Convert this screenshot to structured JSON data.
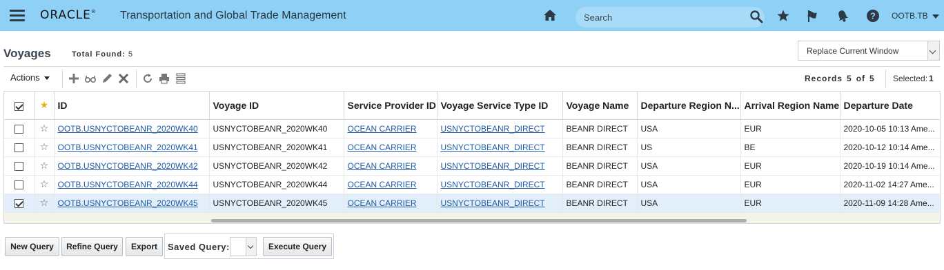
{
  "header": {
    "logo": "ORACLE",
    "logo_mark": "®",
    "app_title": "Transportation and Global Trade Management",
    "search_placeholder": "Search",
    "user": "OOTB.TB"
  },
  "page": {
    "title": "Voyages",
    "total_label": "Total Found:",
    "total_value": "5",
    "window_option": "Replace Current Window"
  },
  "toolbar": {
    "actions_label": "Actions",
    "records_label": "Records",
    "records_current": "5",
    "records_of": "of",
    "records_total": "5",
    "selected_label": "Selected:",
    "selected_value": "1"
  },
  "table": {
    "columns": [
      "ID",
      "Voyage ID",
      "Service Provider ID",
      "Voyage Service Type ID",
      "Voyage Name",
      "Departure Region N...",
      "Arrival Region Name",
      "Departure Date"
    ],
    "rows": [
      {
        "checked": false,
        "id": "OOTB.USNYCTOBEANR_2020WK40",
        "voyage_id": "USNYCTOBEANR_2020WK40",
        "provider": "OCEAN CARRIER",
        "service_type": "USNYCTOBEANR_DIRECT",
        "name": "BEANR DIRECT",
        "dep_region": "USA",
        "arr_region": "EUR",
        "dep_date": "2020-10-05 10:13 Ame..."
      },
      {
        "checked": false,
        "id": "OOTB.USNYCTOBEANR_2020WK41",
        "voyage_id": "USNYCTOBEANR_2020WK41",
        "provider": "OCEAN CARRIER",
        "service_type": "USNYCTOBEANR_DIRECT",
        "name": "BEANR DIRECT",
        "dep_region": "US",
        "arr_region": "BE",
        "dep_date": "2020-10-12 10:14 Ame..."
      },
      {
        "checked": false,
        "id": "OOTB.USNYCTOBEANR_2020WK42",
        "voyage_id": "USNYCTOBEANR_2020WK42",
        "provider": "OCEAN CARRIER",
        "service_type": "USNYCTOBEANR_DIRECT",
        "name": "BEANR DIRECT",
        "dep_region": "USA",
        "arr_region": "EUR",
        "dep_date": "2020-10-19 10:14 Ame..."
      },
      {
        "checked": false,
        "id": "OOTB.USNYCTOBEANR_2020WK44",
        "voyage_id": "USNYCTOBEANR_2020WK44",
        "provider": "OCEAN CARRIER",
        "service_type": "USNYCTOBEANR_DIRECT",
        "name": "BEANR DIRECT",
        "dep_region": "USA",
        "arr_region": "EUR",
        "dep_date": "2020-11-02 14:27 Ame..."
      },
      {
        "checked": true,
        "id": "OOTB.USNYCTOBEANR_2020WK45",
        "voyage_id": "USNYCTOBEANR_2020WK45",
        "provider": "OCEAN CARRIER",
        "service_type": "USNYCTOBEANR_DIRECT",
        "name": "BEANR DIRECT",
        "dep_region": "USA",
        "arr_region": "EUR",
        "dep_date": "2020-11-09 14:28 Ame..."
      }
    ]
  },
  "footer": {
    "new_query": "New Query",
    "refine_query": "Refine Query",
    "export": "Export",
    "saved_query_label": "Saved Query:",
    "execute_query": "Execute Query"
  },
  "icons": {
    "menu": "hamburger-icon",
    "home": "home-icon",
    "search": "search-icon",
    "favorites": "star-icon",
    "flag": "flag-icon",
    "notifications": "bell-icon",
    "help": "help-icon",
    "add": "plus-icon",
    "view": "glasses-icon",
    "edit": "pencil-icon",
    "delete": "close-icon",
    "refresh": "refresh-icon",
    "print": "print-icon",
    "layout": "list-icon"
  },
  "colors": {
    "header_bg": "#8fd1f6",
    "link": "#1f5aa6",
    "selected_row": "#e2eefa",
    "favorite_star": "#e8b60f"
  }
}
